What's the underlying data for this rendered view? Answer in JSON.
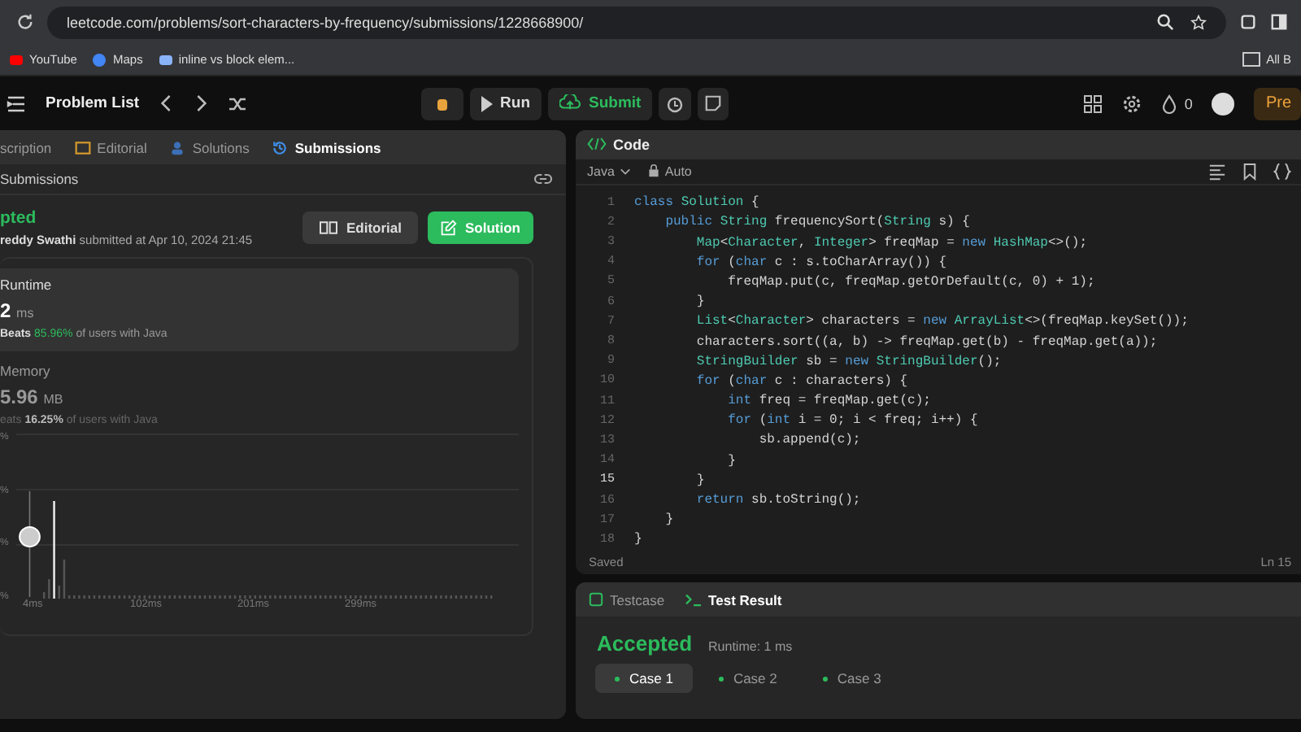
{
  "browser": {
    "url": "leetcode.com/problems/sort-characters-by-frequency/submissions/1228668900/",
    "bookmarks": [
      "YouTube",
      "Maps",
      "inline vs block elem..."
    ],
    "all_bookmarks": "All B"
  },
  "topbar": {
    "problem_list": "Problem List",
    "run": "Run",
    "submit": "Submit",
    "streak": "0",
    "premium": "Pre"
  },
  "left_tabs": [
    {
      "label": "scription",
      "selected": false
    },
    {
      "label": "Editorial",
      "selected": false
    },
    {
      "label": "Solutions",
      "selected": false
    },
    {
      "label": "Submissions",
      "selected": true
    }
  ],
  "submissions_header": "Submissions",
  "result": {
    "status": "pted",
    "user": "reddy Swathi",
    "submitted": " submitted at Apr 10, 2024 21:45",
    "editorial_button": "Editorial",
    "solution_button": "Solution"
  },
  "runtime": {
    "label": "Runtime",
    "value": "2",
    "unit": "ms",
    "beats": "Beats",
    "percent": "85.96%",
    "suffix": "of users with Java"
  },
  "memory": {
    "label": "Memory",
    "value": "5.96",
    "unit": "MB",
    "beats": "eats",
    "percent": "16.25%",
    "suffix": "of users with Java"
  },
  "chart": {
    "y_labels": [
      "%",
      "%",
      "%",
      "%"
    ],
    "x_labels": [
      "4ms",
      "102ms",
      "201ms",
      "299ms"
    ]
  },
  "code_panel": {
    "title": "Code",
    "language": "Java",
    "mode": "Auto",
    "status": "Saved",
    "position": "Ln 15",
    "lines": [
      {
        "num": "1",
        "current": false,
        "tokens": [
          {
            "kind": "keyword",
            "text": "class "
          },
          {
            "kind": "type",
            "text": "Solution"
          },
          {
            "kind": "plain",
            "text": " {"
          }
        ]
      },
      {
        "num": "2",
        "current": false,
        "tokens": [
          {
            "kind": "keyword",
            "text": "    public "
          },
          {
            "kind": "type",
            "text": "String"
          },
          {
            "kind": "plain",
            "text": " frequencySort("
          },
          {
            "kind": "type",
            "text": "String"
          },
          {
            "kind": "plain",
            "text": " s) {"
          }
        ]
      },
      {
        "num": "3",
        "current": false,
        "tokens": [
          {
            "kind": "type",
            "text": "        Map"
          },
          {
            "kind": "plain",
            "text": "<"
          },
          {
            "kind": "type",
            "text": "Character"
          },
          {
            "kind": "plain",
            "text": ", "
          },
          {
            "kind": "type",
            "text": "Integer"
          },
          {
            "kind": "plain",
            "text": "> freqMap = "
          },
          {
            "kind": "keyword",
            "text": "new "
          },
          {
            "kind": "type",
            "text": "HashMap"
          },
          {
            "kind": "plain",
            "text": "<>();"
          }
        ]
      },
      {
        "num": "4",
        "current": false,
        "tokens": [
          {
            "kind": "keyword",
            "text": "        for"
          },
          {
            "kind": "plain",
            "text": " ("
          },
          {
            "kind": "keyword",
            "text": "char"
          },
          {
            "kind": "plain",
            "text": " c : s.toCharArray()) {"
          }
        ]
      },
      {
        "num": "5",
        "current": false,
        "tokens": [
          {
            "kind": "plain",
            "text": "            freqMap.put(c, freqMap.getOrDefault(c, 0) + 1);"
          }
        ]
      },
      {
        "num": "6",
        "current": false,
        "tokens": [
          {
            "kind": "plain",
            "text": "        }"
          }
        ]
      },
      {
        "num": "7",
        "current": false,
        "tokens": [
          {
            "kind": "type",
            "text": "        List"
          },
          {
            "kind": "plain",
            "text": "<"
          },
          {
            "kind": "type",
            "text": "Character"
          },
          {
            "kind": "plain",
            "text": "> characters = "
          },
          {
            "kind": "keyword",
            "text": "new "
          },
          {
            "kind": "type",
            "text": "ArrayList"
          },
          {
            "kind": "plain",
            "text": "<>(freqMap.keySet());"
          }
        ]
      },
      {
        "num": "8",
        "current": false,
        "tokens": [
          {
            "kind": "plain",
            "text": "        characters.sort((a, b) -> freqMap.get(b) - freqMap.get(a));"
          }
        ]
      },
      {
        "num": "9",
        "current": false,
        "tokens": [
          {
            "kind": "type",
            "text": "        StringBuilder"
          },
          {
            "kind": "plain",
            "text": " sb = "
          },
          {
            "kind": "keyword",
            "text": "new "
          },
          {
            "kind": "type",
            "text": "StringBuilder"
          },
          {
            "kind": "plain",
            "text": "();"
          }
        ]
      },
      {
        "num": "10",
        "current": false,
        "tokens": [
          {
            "kind": "keyword",
            "text": "        for"
          },
          {
            "kind": "plain",
            "text": " ("
          },
          {
            "kind": "keyword",
            "text": "char"
          },
          {
            "kind": "plain",
            "text": " c : characters) {"
          }
        ]
      },
      {
        "num": "11",
        "current": false,
        "tokens": [
          {
            "kind": "keyword",
            "text": "            int"
          },
          {
            "kind": "plain",
            "text": " freq = freqMap.get(c);"
          }
        ]
      },
      {
        "num": "12",
        "current": false,
        "tokens": [
          {
            "kind": "keyword",
            "text": "            for"
          },
          {
            "kind": "plain",
            "text": " ("
          },
          {
            "kind": "keyword",
            "text": "int"
          },
          {
            "kind": "plain",
            "text": " i = 0; i < freq; i++) {"
          }
        ]
      },
      {
        "num": "13",
        "current": false,
        "tokens": [
          {
            "kind": "plain",
            "text": "                sb.append(c);"
          }
        ]
      },
      {
        "num": "14",
        "current": false,
        "tokens": [
          {
            "kind": "plain",
            "text": "            }"
          }
        ]
      },
      {
        "num": "15",
        "current": true,
        "tokens": [
          {
            "kind": "plain",
            "text": "        }"
          }
        ]
      },
      {
        "num": "16",
        "current": false,
        "tokens": [
          {
            "kind": "keyword",
            "text": "        return"
          },
          {
            "kind": "plain",
            "text": " sb.toString();"
          }
        ]
      },
      {
        "num": "17",
        "current": false,
        "tokens": [
          {
            "kind": "plain",
            "text": "    }"
          }
        ]
      },
      {
        "num": "18",
        "current": false,
        "tokens": [
          {
            "kind": "plain",
            "text": "}"
          }
        ]
      }
    ]
  },
  "test_tabs": [
    {
      "label": "Testcase",
      "selected": false
    },
    {
      "label": "Test Result",
      "selected": true
    }
  ],
  "test_result": {
    "status": "Accepted",
    "runtime": "Runtime: 1 ms"
  },
  "cases": [
    {
      "label": "Case 1",
      "selected": true
    },
    {
      "label": "Case 2",
      "selected": false
    },
    {
      "label": "Case 3",
      "selected": false
    }
  ]
}
